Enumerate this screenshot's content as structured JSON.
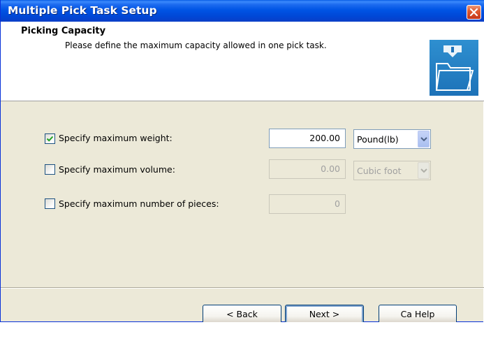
{
  "window": {
    "title": "Multiple Pick Task Setup"
  },
  "header": {
    "title": "Picking Capacity",
    "subtitle": "Please  define the maximum capacity allowed in one pick task.",
    "icon": "folder-download-icon"
  },
  "form": {
    "rows": [
      {
        "label": "Specify maximum weight:",
        "checked": true,
        "value": "200.00",
        "unit": "Pound(lb)",
        "enabled": true
      },
      {
        "label": "Specify maximum volume:",
        "checked": false,
        "value": "0.00",
        "unit": "Cubic foot",
        "enabled": false
      },
      {
        "label": "Specify maximum number of pieces:",
        "checked": false,
        "value": "0",
        "enabled": false
      }
    ]
  },
  "buttons": {
    "back": "< Back",
    "next": "Next >",
    "cancel_help": "Ca  Help"
  },
  "colors": {
    "titlebar": "#0055e5",
    "dialog_bg": "#ece9d8",
    "close": "#e05a2f"
  }
}
